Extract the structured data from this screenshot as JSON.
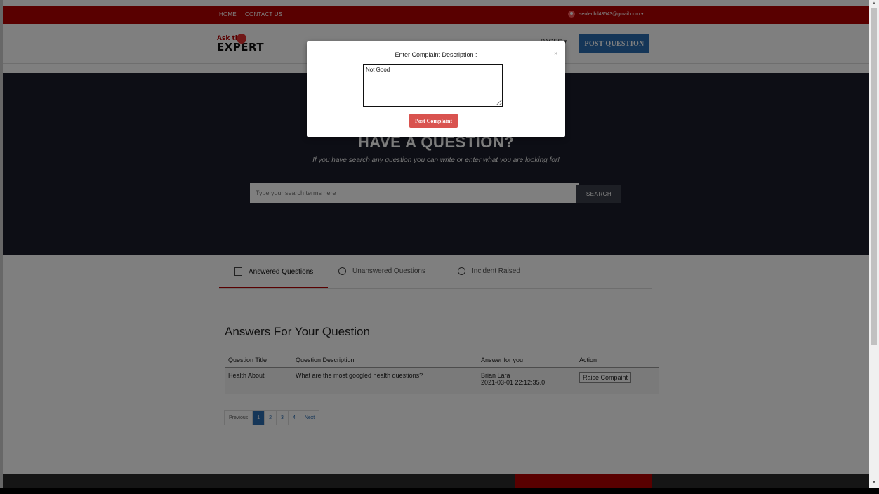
{
  "topbar": {
    "home": "HOME",
    "contact": "CONTACT US",
    "user_email": "seuledhil43543@gmail.com ▾"
  },
  "header": {
    "logo_ask": "Ask the",
    "logo_expert": "EXPERT",
    "pages": "PAGES ▾",
    "post_question": "POST QUESTION"
  },
  "hero": {
    "title": "HAVE A QUESTION?",
    "subtitle": "If you have search any question you can write or enter what you are looking for!",
    "search_placeholder": "Type your search terms here",
    "search_button": "SEARCH"
  },
  "tabs": [
    {
      "label": "Answered Questions"
    },
    {
      "label": "Unanswered Questions"
    },
    {
      "label": "Incident Raised"
    }
  ],
  "answers": {
    "title": "Answers For Your Question",
    "columns": [
      "Question Title",
      "Question Description",
      "Answer for you",
      "Action"
    ],
    "rows": [
      {
        "title": "Health About",
        "description": "What are the most googled health questions?",
        "answer_name": "Brian Lara",
        "answer_time": "2021-03-01 22:12:35.0",
        "action": "Raise Compaint"
      }
    ]
  },
  "pagination": {
    "previous": "Previous",
    "pages": [
      "1",
      "2",
      "3",
      "4"
    ],
    "next": "Next"
  },
  "modal": {
    "title": "Enter Complaint Description :",
    "close": "×",
    "textarea_value": "Not Good",
    "submit": "Post Complaint"
  },
  "colors": {
    "brand_red": "#b30000",
    "hero_bg": "#1b1d2a",
    "primary_blue": "#2b6cb0",
    "danger": "#d9534f"
  }
}
